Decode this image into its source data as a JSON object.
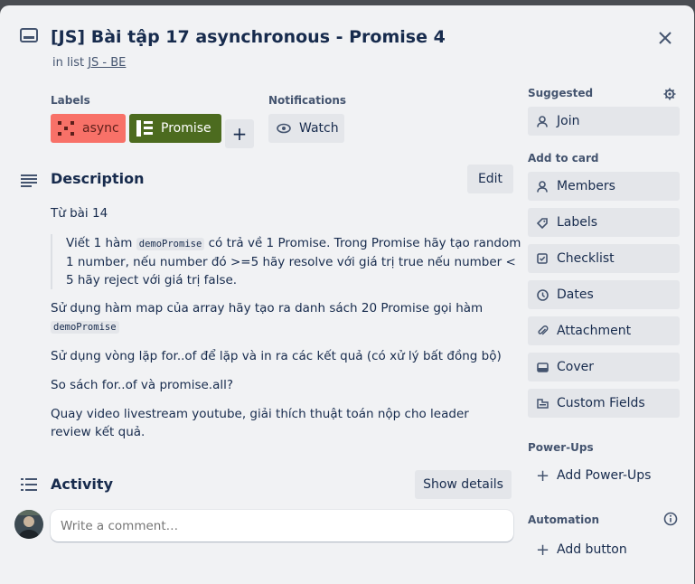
{
  "card": {
    "title": "[JS] Bài tập 17 asynchronous - Promise 4",
    "in_list_prefix": "in list",
    "list_name": "JS - BE"
  },
  "labels": {
    "heading": "Labels",
    "items": [
      {
        "text": "async",
        "color": "#f87168"
      },
      {
        "text": "Promise",
        "color": "#4c6b1f"
      }
    ],
    "add": "+"
  },
  "notifications": {
    "heading": "Notifications",
    "watch": "Watch"
  },
  "description": {
    "heading": "Description",
    "edit": "Edit",
    "p1": "Từ bài 14",
    "quote_pre": "Viết 1 hàm",
    "quote_code": "demoPromise",
    "quote_post": "có trả về 1 Promise. Trong Promise hãy tạo random 1 number, nếu number đó >=5 hãy resolve với giá trị true nếu number < 5 hãy reject với giá trị false.",
    "p2_text": "Sử dụng hàm map của array hãy tạo ra danh sách 20 Promise gọi hàm",
    "p2_code": "demoPromise",
    "p3": "Sử dụng vòng lặp for..of để lặp và in ra các kết quả (có xử lý bất đồng bộ)",
    "p4": "So sách for..of và promise.all?",
    "p5": "Quay video livestream youtube, giải thích thuật toán nộp cho leader review kết quả."
  },
  "activity": {
    "heading": "Activity",
    "show_details": "Show details",
    "comment_placeholder": "Write a comment…"
  },
  "sidebar": {
    "suggested": "Suggested",
    "join": "Join",
    "add_to_card": "Add to card",
    "items": [
      {
        "label": "Members",
        "icon": "person-icon"
      },
      {
        "label": "Labels",
        "icon": "tag-icon"
      },
      {
        "label": "Checklist",
        "icon": "checklist-icon"
      },
      {
        "label": "Dates",
        "icon": "clock-icon"
      },
      {
        "label": "Attachment",
        "icon": "paperclip-icon"
      },
      {
        "label": "Cover",
        "icon": "cover-icon"
      },
      {
        "label": "Custom Fields",
        "icon": "custom-fields-icon"
      }
    ],
    "power_ups": "Power-Ups",
    "add_power_ups": "Add Power-Ups",
    "automation": "Automation",
    "add_button": "Add button"
  }
}
